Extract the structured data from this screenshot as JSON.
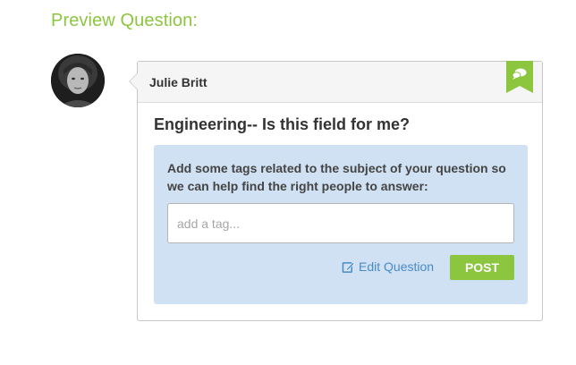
{
  "page": {
    "heading": "Preview Question:"
  },
  "author": {
    "name": "Julie Britt",
    "avatar_icon": "user-avatar-photo"
  },
  "question": {
    "title": "Engineering-- Is this field for me?"
  },
  "tags": {
    "prompt": "Add some tags related to the subject of your question so we can help find the right people to answer:",
    "input_value": "",
    "input_placeholder": "add a tag..."
  },
  "actions": {
    "edit_label": "Edit Question",
    "edit_icon": "edit-icon",
    "post_label": "POST"
  },
  "card": {
    "bookmark_icon": "speech-bubbles-icon"
  },
  "colors": {
    "accent_green": "#8cc63f",
    "panel_blue": "#cfe1f2",
    "link_blue": "#4a8bc6",
    "text_dark": "#333333"
  }
}
